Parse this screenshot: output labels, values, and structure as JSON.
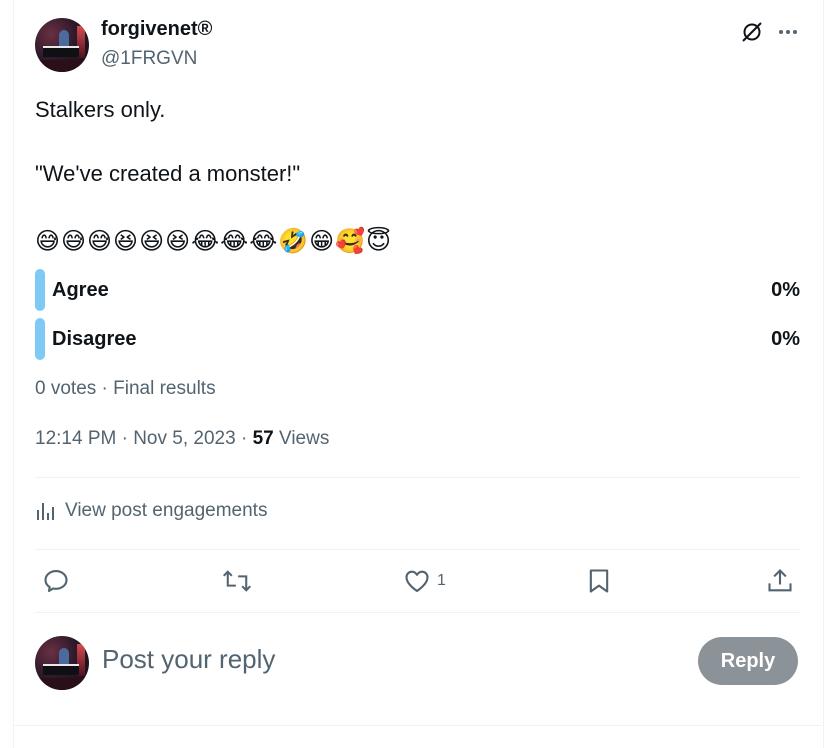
{
  "author": {
    "display_name": "forgivenet®",
    "handle": "@1FRGVN"
  },
  "tweet": {
    "line1": "Stalkers only.",
    "line2": "\"We've created a monster!\"",
    "emojis": "😅😅😅😆😆😆😂😂😂🤣😁🥰😇"
  },
  "poll": {
    "options": [
      {
        "label": "Agree",
        "percent": "0%"
      },
      {
        "label": "Disagree",
        "percent": "0%"
      }
    ],
    "meta": "0 votes · Final results",
    "bar_color": "#7ecaf4"
  },
  "timestamp": {
    "time_date": "12:14 PM · Nov 5, 2023 · ",
    "views_count": "57",
    "views_label": "Views"
  },
  "engagements": {
    "label": "View post engagements"
  },
  "actions": {
    "reply": {
      "icon": "reply-icon"
    },
    "retweet": {
      "icon": "retweet-icon"
    },
    "like": {
      "icon": "heart-icon",
      "count": "1"
    },
    "bookmark": {
      "icon": "bookmark-icon"
    },
    "share": {
      "icon": "share-icon"
    }
  },
  "reply_box": {
    "placeholder": "Post your reply",
    "button_label": "Reply",
    "button_color": "#8b9298"
  },
  "colors": {
    "text_primary": "#0f1419",
    "text_secondary": "#536471",
    "divider": "#eff3f4"
  }
}
